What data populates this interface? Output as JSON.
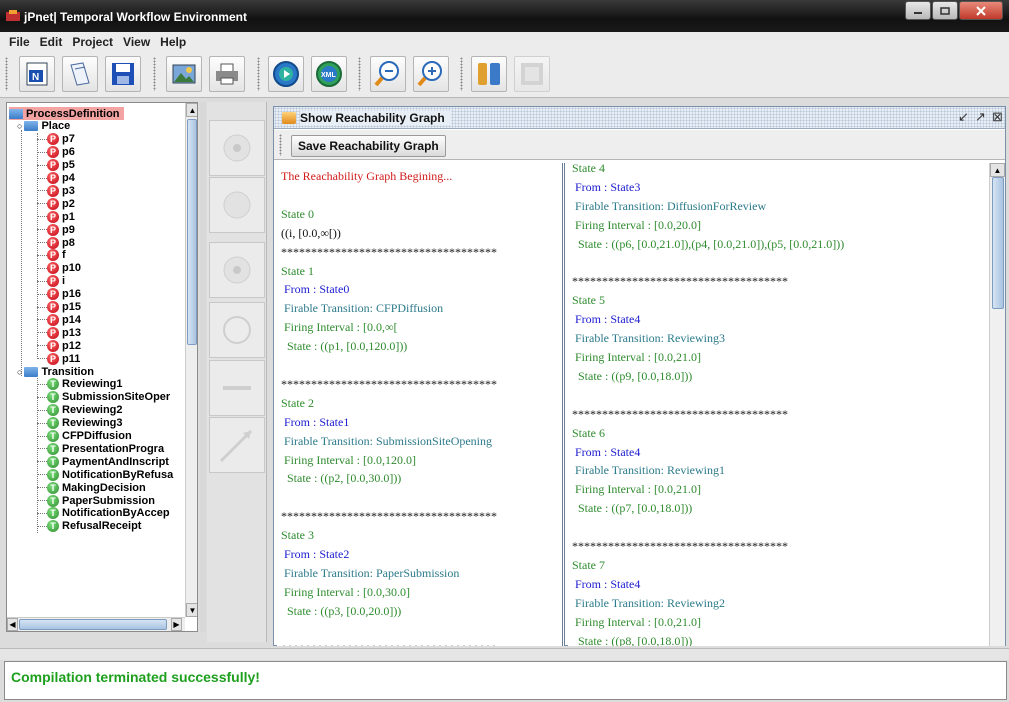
{
  "window": {
    "title": "jPnet| Temporal Workflow Environment"
  },
  "menu": [
    "File",
    "Edit",
    "Project",
    "View",
    "Help"
  ],
  "toolbar": {
    "buttons": [
      "new-net-icon",
      "open-icon",
      "save-icon",
      "image-icon",
      "print-icon",
      "compile-icon",
      "export-xml-icon",
      "zoom-out-icon",
      "zoom-in-icon",
      "settings-icon",
      "disabled-icon"
    ],
    "xml_label": "XML"
  },
  "tree": {
    "root": "ProcessDefinition",
    "place_folder": "Place",
    "places": [
      "p7",
      "p6",
      "p5",
      "p4",
      "p3",
      "p2",
      "p1",
      "p9",
      "p8",
      "f",
      "p10",
      "i",
      "p16",
      "p15",
      "p14",
      "p13",
      "p12",
      "p11"
    ],
    "transition_folder": "Transition",
    "transitions": [
      "Reviewing1",
      "SubmissionSiteOper",
      "Reviewing2",
      "Reviewing3",
      "CFPDiffusion",
      "PresentationProgra",
      "PaymentAndInscript",
      "NotificationByRefusa",
      "MakingDecision",
      "PaperSubmission",
      "NotificationByAccep",
      "RefusalReceipt"
    ],
    "place_letter": "P",
    "transition_letter": "T"
  },
  "graph_window": {
    "title": "Show Reachability Graph",
    "save_button": "Save Reachability Graph",
    "left_lines": [
      {
        "text": "The Reachability Graph Begining...",
        "c": "red"
      },
      {
        "text": "",
        "c": "black"
      },
      {
        "text": "State 0",
        "c": "green"
      },
      {
        "text": "((i, [0.0,∞[))",
        "c": "black"
      },
      {
        "text": "************************************",
        "c": "black"
      },
      {
        "text": "State 1",
        "c": "green"
      },
      {
        "text": " From : State0",
        "c": "blue"
      },
      {
        "text": " Firable Transition: CFPDiffusion",
        "c": "teal"
      },
      {
        "text": " Firing Interval : [0.0,∞[",
        "c": "green"
      },
      {
        "text": "  State : ((p1, [0.0,120.0]))",
        "c": "green"
      },
      {
        "text": "",
        "c": "black"
      },
      {
        "text": "************************************",
        "c": "black"
      },
      {
        "text": "State 2",
        "c": "green"
      },
      {
        "text": " From : State1",
        "c": "blue"
      },
      {
        "text": " Firable Transition: SubmissionSiteOpening",
        "c": "teal"
      },
      {
        "text": " Firing Interval : [0.0,120.0]",
        "c": "green"
      },
      {
        "text": "  State : ((p2, [0.0,30.0]))",
        "c": "green"
      },
      {
        "text": "",
        "c": "black"
      },
      {
        "text": "************************************",
        "c": "black"
      },
      {
        "text": "State 3",
        "c": "green"
      },
      {
        "text": " From : State2",
        "c": "blue"
      },
      {
        "text": " Firable Transition: PaperSubmission",
        "c": "teal"
      },
      {
        "text": " Firing Interval : [0.0,30.0]",
        "c": "green"
      },
      {
        "text": "  State : ((p3, [0.0,20.0]))",
        "c": "green"
      },
      {
        "text": "",
        "c": "black"
      },
      {
        "text": "************************************",
        "c": "black"
      }
    ],
    "right_lines": [
      {
        "text": "State 4",
        "c": "green"
      },
      {
        "text": " From : State3",
        "c": "blue"
      },
      {
        "text": " Firable Transition: DiffusionForReview",
        "c": "teal"
      },
      {
        "text": " Firing Interval : [0.0,20.0]",
        "c": "green"
      },
      {
        "text": "  State : ((p6, [0.0,21.0]),(p4, [0.0,21.0]),(p5, [0.0,21.0]))",
        "c": "green"
      },
      {
        "text": "",
        "c": "black"
      },
      {
        "text": "************************************",
        "c": "black"
      },
      {
        "text": "State 5",
        "c": "green"
      },
      {
        "text": " From : State4",
        "c": "blue"
      },
      {
        "text": " Firable Transition: Reviewing3",
        "c": "teal"
      },
      {
        "text": " Firing Interval : [0.0,21.0]",
        "c": "green"
      },
      {
        "text": "  State : ((p9, [0.0,18.0]))",
        "c": "green"
      },
      {
        "text": "",
        "c": "black"
      },
      {
        "text": "************************************",
        "c": "black"
      },
      {
        "text": "State 6",
        "c": "green"
      },
      {
        "text": " From : State4",
        "c": "blue"
      },
      {
        "text": " Firable Transition: Reviewing1",
        "c": "teal"
      },
      {
        "text": " Firing Interval : [0.0,21.0]",
        "c": "green"
      },
      {
        "text": "  State : ((p7, [0.0,18.0]))",
        "c": "green"
      },
      {
        "text": "",
        "c": "black"
      },
      {
        "text": "************************************",
        "c": "black"
      },
      {
        "text": "State 7",
        "c": "green"
      },
      {
        "text": " From : State4",
        "c": "blue"
      },
      {
        "text": " Firable Transition: Reviewing2",
        "c": "teal"
      },
      {
        "text": " Firing Interval : [0.0,21.0]",
        "c": "green"
      },
      {
        "text": "  State : ((p8, [0.0,18.0]))",
        "c": "green"
      }
    ]
  },
  "console": {
    "message": "Compilation terminated successfully!"
  },
  "colors": {
    "success": "#1ea01e",
    "root_highlight": "#f4a3a3"
  }
}
